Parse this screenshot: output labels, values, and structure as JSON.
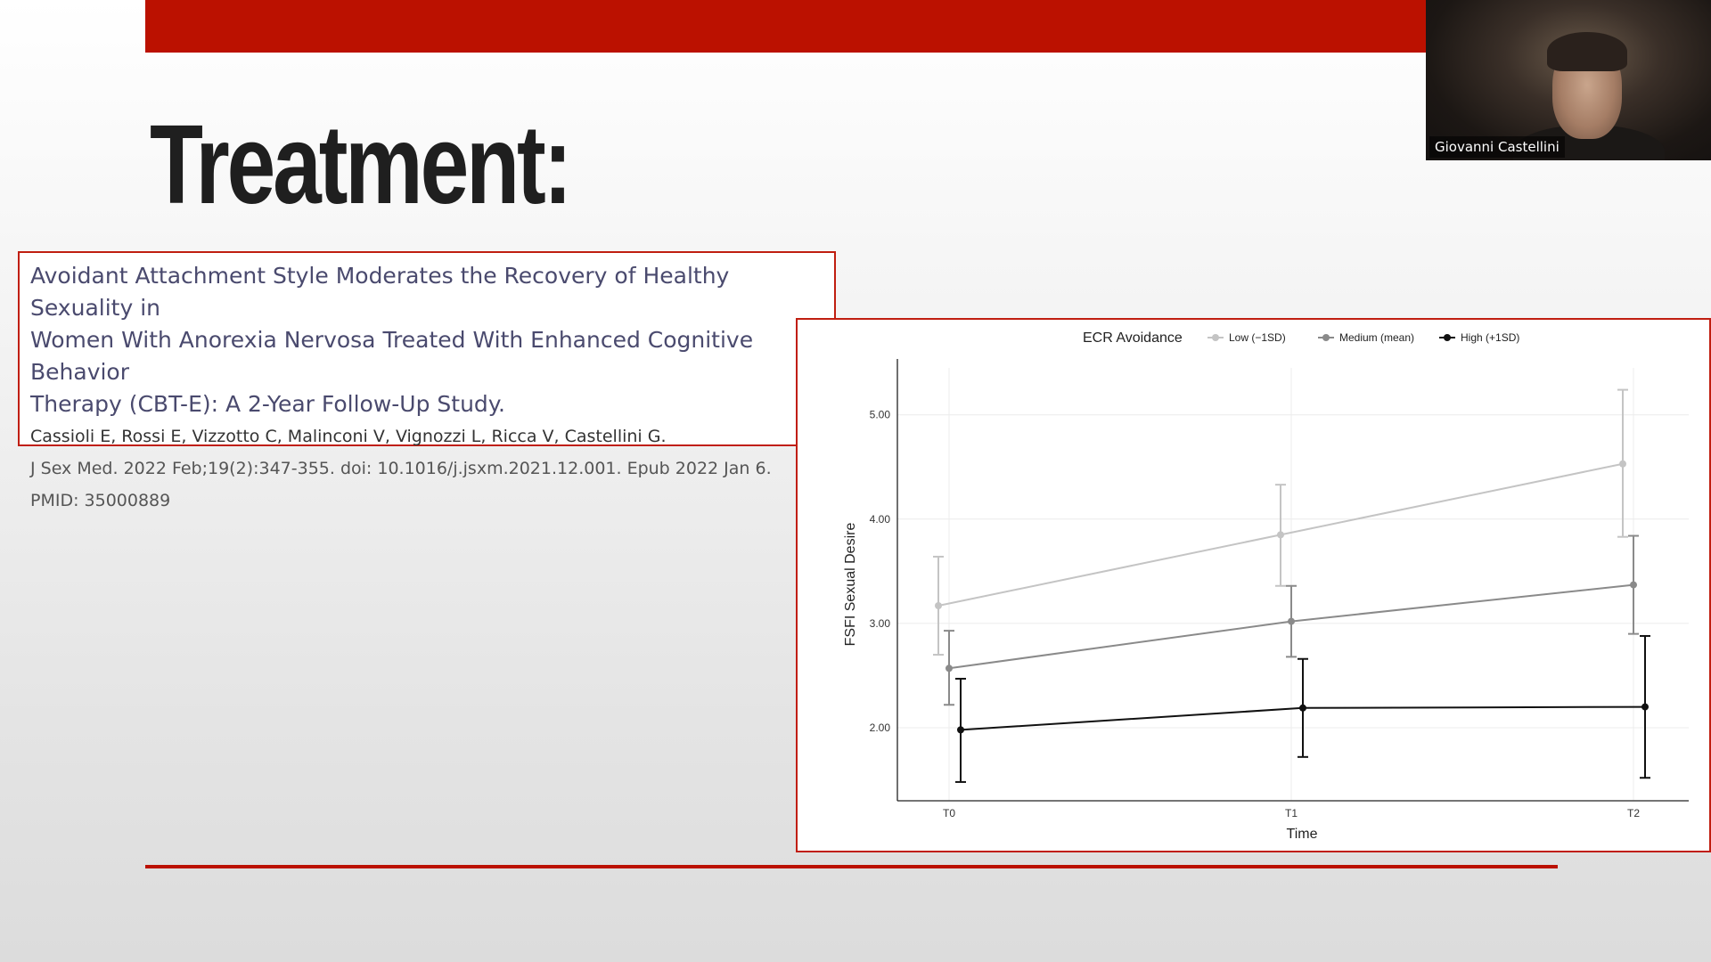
{
  "slide": {
    "title": "Treatment:",
    "accent_color": "#bb1100"
  },
  "citation": {
    "title": "Avoidant Attachment Style Moderates the Recovery of Healthy Sexuality in Women With Anorexia Nervosa Treated With Enhanced Cognitive Behavior Therapy (CBT-E): A 2-Year Follow-Up Study.",
    "title_lines": [
      "Avoidant Attachment Style Moderates the Recovery of Healthy Sexuality in",
      "Women With Anorexia Nervosa Treated With Enhanced Cognitive Behavior",
      "Therapy (CBT-E): A 2-Year Follow-Up Study."
    ],
    "authors": "Cassioli E, Rossi E, Vizzotto C, Malinconi V, Vignozzi L, Ricca V, Castellini G.",
    "journal": "J Sex Med. 2022 Feb;19(2):347-355. doi: 10.1016/j.jsxm.2021.12.001. Epub 2022 Jan 6.",
    "pmid": "PMID: 35000889"
  },
  "webcam": {
    "participant_name": "Giovanni Castellini"
  },
  "chart_data": {
    "type": "line",
    "legend_title": "ECR Avoidance",
    "legend_position": "top",
    "xlabel": "Time",
    "ylabel": "FSFI Sexual Desire",
    "categories": [
      "T0",
      "T1",
      "T2"
    ],
    "y_ticks": [
      "2.00",
      "3.00",
      "4.00",
      "5.00"
    ],
    "ylim": [
      1.3,
      5.45
    ],
    "grid": true,
    "series": [
      {
        "name": "Low (−1SD)",
        "color": "#c4c4c4",
        "values": [
          3.17,
          3.85,
          4.53
        ],
        "error_low": [
          2.7,
          3.36,
          3.83
        ],
        "error_high": [
          3.64,
          4.33,
          5.24
        ]
      },
      {
        "name": "Medium (mean)",
        "color": "#8a8a8a",
        "values": [
          2.57,
          3.02,
          3.37
        ],
        "error_low": [
          2.22,
          2.68,
          2.9
        ],
        "error_high": [
          2.93,
          3.36,
          3.84
        ]
      },
      {
        "name": "High (+1SD)",
        "color": "#111111",
        "values": [
          1.98,
          2.19,
          2.2
        ],
        "error_low": [
          1.48,
          1.72,
          1.52
        ],
        "error_high": [
          2.47,
          2.66,
          2.88
        ]
      }
    ]
  }
}
